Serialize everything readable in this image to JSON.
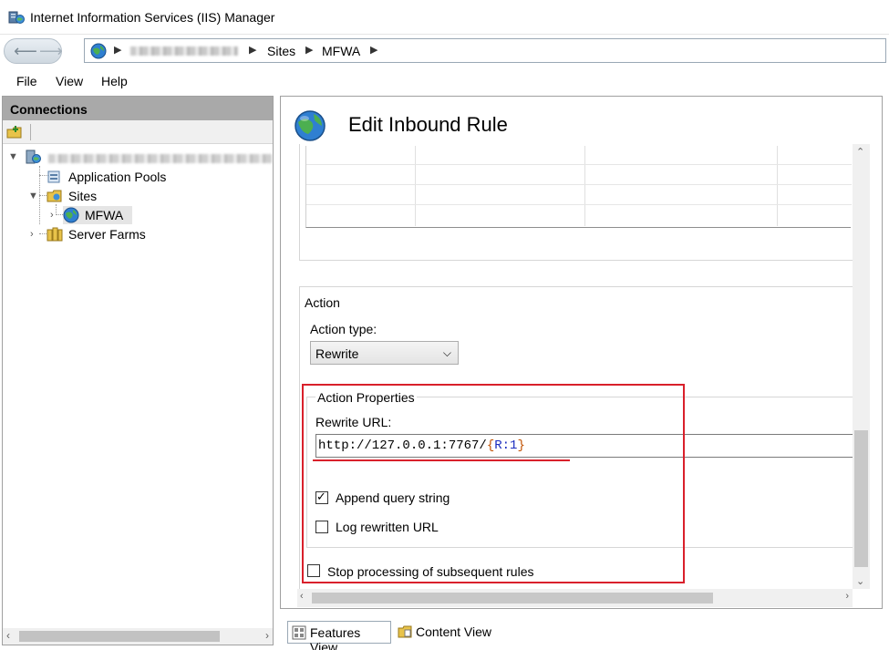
{
  "window": {
    "title": "Internet Information Services (IIS) Manager"
  },
  "breadcrumb": {
    "items": [
      "Sites",
      "MFWA"
    ]
  },
  "menu": {
    "file": "File",
    "view": "View",
    "help": "Help"
  },
  "connections": {
    "header": "Connections",
    "tree": {
      "app_pools": "Application Pools",
      "sites": "Sites",
      "mfwa": "MFWA",
      "server_farms": "Server Farms"
    }
  },
  "page": {
    "title": "Edit Inbound Rule",
    "action": {
      "section_title": "Action",
      "type_label": "Action type:",
      "type_value": "Rewrite",
      "properties_title": "Action Properties",
      "rewrite_url_label": "Rewrite URL:",
      "rewrite_url_base": "http://127.0.0.1:7767/",
      "rewrite_url_open": "{",
      "rewrite_url_var": "R:1",
      "rewrite_url_close": "}",
      "append_query_label": "Append query string",
      "append_query_checked": true,
      "log_rewritten_label": "Log rewritten URL",
      "log_rewritten_checked": false,
      "stop_processing_label": "Stop processing of subsequent rules",
      "stop_processing_checked": false
    }
  },
  "bottom_tabs": {
    "features_view": "Features View",
    "content_view": "Content View"
  },
  "colors": {
    "highlight_red": "#d9202b",
    "url_brace": "#c05000",
    "url_var": "#1a2cbf",
    "pane_header": "#a9a9a9"
  }
}
